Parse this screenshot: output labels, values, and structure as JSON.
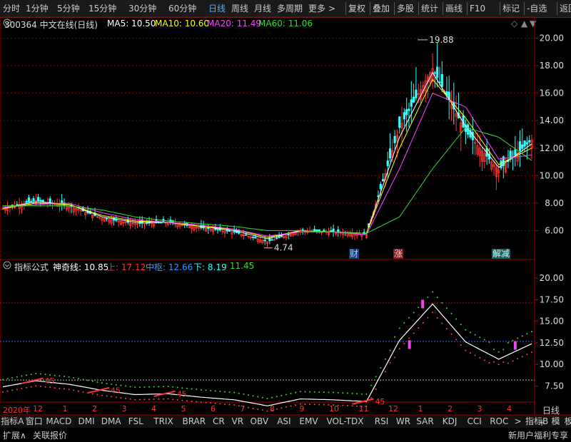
{
  "toolbar": {
    "left_items": [
      "分时",
      "1分钟",
      "5分钟",
      "15分钟",
      "30分钟",
      "60分钟",
      "日线",
      "周线",
      "月线",
      "多周期",
      "更多"
    ],
    "more_arrow": ">",
    "right_items": [
      "复权",
      "叠加",
      "多股",
      "统计",
      "画线",
      "F10",
      "标记",
      "-自选",
      "返回"
    ],
    "active": "日线"
  },
  "main": {
    "code_title": "300364 中文在线(日线)",
    "ma5": "MA5: 10.50",
    "ma10": "MA10: 10.60",
    "ma20": "MA20: 11.49",
    "ma60": "MA60: 11.06",
    "high_label": "19.88",
    "low_label": "4.74",
    "y_ticks": [
      "20.00",
      "18.00",
      "16.00",
      "14.00",
      "12.00",
      "10.00",
      "8.00",
      "6.00"
    ],
    "markers": [
      "财",
      "涨",
      "解减"
    ],
    "controls": [
      "◇",
      "▲",
      "▼"
    ],
    "colors": {
      "ma5": "#ffffff",
      "ma10": "#ffff00",
      "ma20": "#ff44ff",
      "ma60": "#33dd33",
      "up": "#ff3333",
      "down": "#33ffff"
    }
  },
  "indicator": {
    "name": "指标公式",
    "line_label": "神奇线: 10.85",
    "upper": "上: 17.12",
    "middle": "中枢: 12.66",
    "lower": "下: 8.19",
    "extra": ": 11.45",
    "y_ticks": [
      "20.00",
      "17.50",
      "15.00",
      "12.50",
      "10.00",
      "7.50"
    ],
    "tag": "45"
  },
  "time_axis": {
    "year_label": "2020年",
    "months": [
      "12",
      "1",
      "2",
      "3",
      "4",
      "5",
      "6",
      "7",
      "8",
      "9",
      "10",
      "11",
      "12",
      "1",
      "2",
      "3",
      "4"
    ],
    "period": "日线"
  },
  "tabs": [
    "指标A",
    "窗口",
    "MACD",
    "DMI",
    "DMA",
    "FSL",
    "TRIX",
    "BRAR",
    "CR",
    "VR",
    "OBV",
    "ASI",
    "EMV",
    "VOL-TDX",
    "RSI",
    "WR",
    "SAR",
    "KDJ",
    "CCI",
    "ROC",
    ">",
    "指标B",
    "模",
    "板"
  ],
  "footer": {
    "expand": "扩展∧",
    "related": "关联报价",
    "plus": "+",
    "minus": "-",
    "promo": "新用户福利专享"
  },
  "chart_data": {
    "type": "candlestick",
    "title": "300364 中文在线(日线)",
    "x": [
      "2020-12",
      "2021-01",
      "2021-02",
      "2021-03",
      "2021-04",
      "2021-05",
      "2021-06",
      "2021-07",
      "2021-08",
      "2021-09",
      "2021-10",
      "2021-11",
      "2021-12",
      "2022-01",
      "2022-02",
      "2022-03",
      "2022-04"
    ],
    "close": [
      7.6,
      8.2,
      7.8,
      6.9,
      6.5,
      6.6,
      6.2,
      5.9,
      5.2,
      6.0,
      5.9,
      5.7,
      13.5,
      17.8,
      13.2,
      10.4,
      12.6
    ],
    "series": [
      {
        "name": "MA5",
        "values": [
          7.6,
          8.1,
          7.9,
          7.0,
          6.6,
          6.6,
          6.3,
          6.0,
          5.4,
          6.0,
          5.9,
          5.8,
          12.8,
          17.5,
          13.6,
          10.6,
          12.3
        ]
      },
      {
        "name": "MA10",
        "values": [
          7.6,
          8.0,
          7.9,
          7.1,
          6.7,
          6.6,
          6.3,
          6.1,
          5.5,
          6.0,
          5.9,
          5.8,
          12.0,
          17.0,
          14.2,
          10.8,
          12.0
        ]
      },
      {
        "name": "MA20",
        "values": [
          7.7,
          7.9,
          8.0,
          7.3,
          6.8,
          6.6,
          6.4,
          6.1,
          5.6,
          5.9,
          5.9,
          5.7,
          10.5,
          16.0,
          15.0,
          11.2,
          11.5
        ]
      },
      {
        "name": "MA60",
        "values": [
          7.8,
          7.8,
          7.8,
          7.5,
          7.0,
          6.7,
          6.5,
          6.3,
          6.0,
          6.0,
          5.9,
          5.8,
          7.0,
          10.5,
          13.5,
          12.8,
          11.1
        ]
      }
    ],
    "ylim": [
      4.0,
      20.6
    ],
    "annotations": [
      {
        "label": "19.88",
        "x": "2021-12"
      },
      {
        "label": "4.74",
        "x": "2021-08"
      }
    ],
    "indicator": {
      "name": "神奇线",
      "values": [
        7.4,
        8.1,
        7.7,
        7.0,
        6.5,
        6.6,
        6.2,
        5.9,
        5.2,
        6.0,
        5.9,
        5.7,
        12.8,
        17.0,
        12.6,
        10.6,
        12.4
      ],
      "upper": 17.12,
      "middle": 12.66,
      "lower": 8.19,
      "ylim": [
        5.8,
        21.0
      ]
    }
  }
}
